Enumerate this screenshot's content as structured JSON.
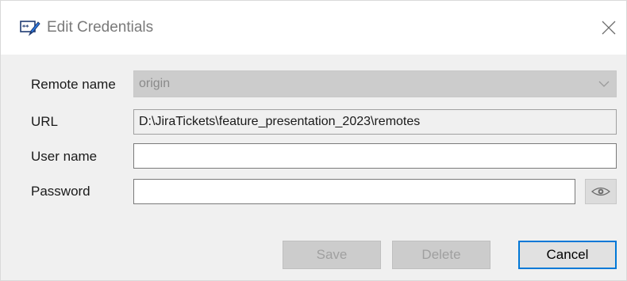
{
  "window": {
    "title": "Edit Credentials",
    "app_icon": "credential-edit-icon",
    "close_icon": "close-icon"
  },
  "form": {
    "remote_name": {
      "label": "Remote name",
      "value": "origin"
    },
    "url": {
      "label": "URL",
      "value": "D:\\JiraTickets\\feature_presentation_2023\\remotes"
    },
    "user_name": {
      "label": "User name",
      "value": ""
    },
    "password": {
      "label": "Password",
      "value": "",
      "reveal_icon": "eye-icon"
    }
  },
  "buttons": {
    "save": "Save",
    "delete": "Delete",
    "cancel": "Cancel"
  },
  "colors": {
    "focus_border": "#0078d7",
    "disabled_bg": "#cccccc",
    "window_bg": "#f0f0f0"
  }
}
